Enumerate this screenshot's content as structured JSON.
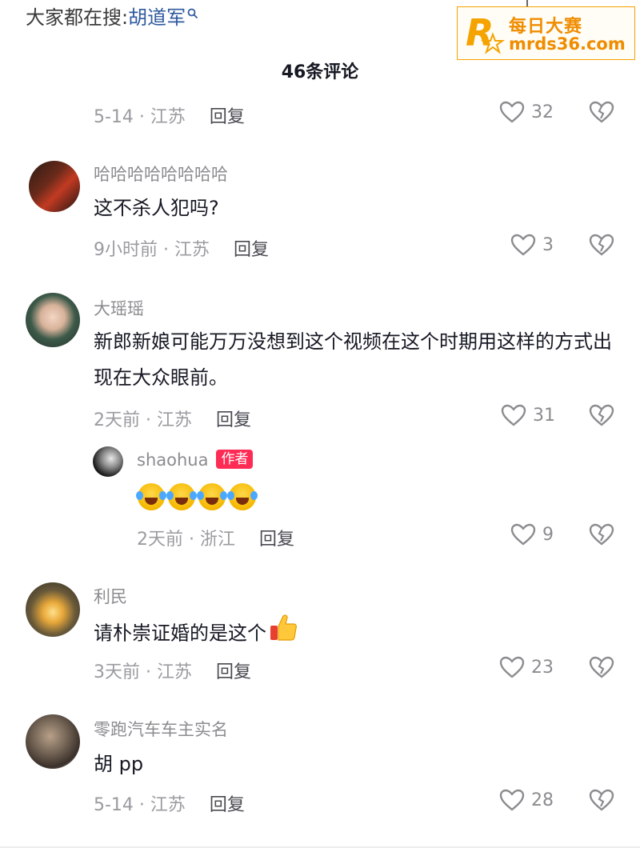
{
  "search": {
    "prefix": "大家都在搜:",
    "keyword": "胡道军"
  },
  "watermark": {
    "line1": "每日大赛",
    "line2": "mrds36.com"
  },
  "header": {
    "comment_count": "46条评论"
  },
  "reply_label": "回复",
  "comments": [
    {
      "meta": "5-14 · 江苏",
      "likes": "32"
    },
    {
      "username": "哈哈哈哈哈哈哈哈",
      "text": "这不杀人犯吗?",
      "meta": "9小时前 · 江苏",
      "likes": "3"
    },
    {
      "username": "大瑶瑶",
      "text": "新郎新娘可能万万没想到这个视频在这个时期用这样的方式出现在大众眼前。",
      "meta": "2天前 · 江苏",
      "likes": "31"
    },
    {
      "username": "shaohua",
      "badge": "作者",
      "text": "",
      "meta": "2天前 · 浙江",
      "likes": "9"
    },
    {
      "username": "利民",
      "text": "请朴崇证婚的是这个",
      "meta": "3天前 · 江苏",
      "likes": "23"
    },
    {
      "username": "零跑汽车车主实名",
      "text": "胡 pp",
      "meta": "5-14 · 江苏",
      "likes": "28"
    }
  ],
  "colors": {
    "author_badge": "#fe2c55",
    "keyword": "#2f5a9e",
    "watermark": "#f08c00"
  }
}
